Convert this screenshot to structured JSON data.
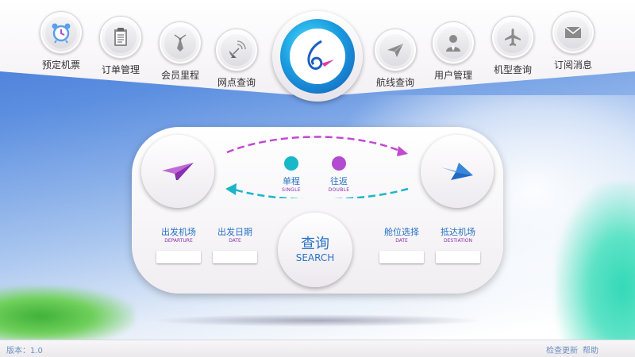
{
  "nav": {
    "items": [
      {
        "label": "预定机票",
        "icon": "alarm-clock-icon"
      },
      {
        "label": "订单管理",
        "icon": "clipboard-icon"
      },
      {
        "label": "会员里程",
        "icon": "tie-icon"
      },
      {
        "label": "网点查询",
        "icon": "satellite-dish-icon"
      },
      {
        "label": "航线查询",
        "icon": "paper-plane-icon"
      },
      {
        "label": "用户管理",
        "icon": "user-icon"
      },
      {
        "label": "机型查询",
        "icon": "airplane-icon"
      },
      {
        "label": "订阅消息",
        "icon": "envelope-icon"
      }
    ]
  },
  "search": {
    "trip": {
      "single_cn": "单程",
      "single_en": "SINGLE",
      "double_cn": "往返",
      "double_en": "DOUBLE"
    },
    "fields": {
      "departure_cn": "出发机场",
      "departure_en": "DEPARTURE",
      "date_cn": "出发日期",
      "date_en": "DATE",
      "cabin_cn": "舱位选择",
      "cabin_en": "DATE",
      "destination_cn": "抵达机场",
      "destination_en": "DESTIATION"
    },
    "button_cn": "查询",
    "button_en": "SEARCH"
  },
  "status": {
    "version": "版本：1.0",
    "check_update": "检查更新",
    "help": "帮助"
  },
  "colors": {
    "accent_blue": "#2a73c5",
    "accent_purple": "#8a2fb0",
    "dot_single": "#18b8c8",
    "dot_double": "#b24bd0"
  }
}
